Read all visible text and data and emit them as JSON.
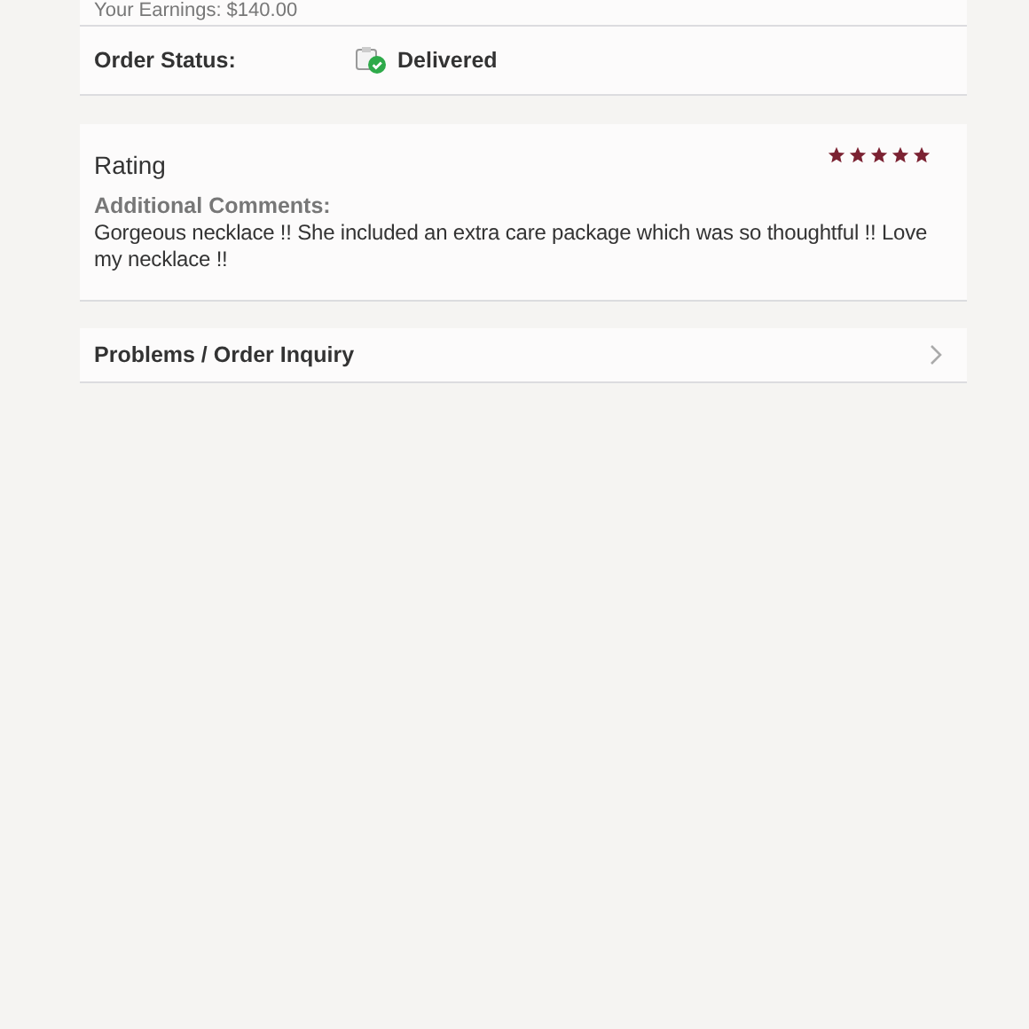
{
  "earnings": {
    "text": "Your Earnings: $140.00"
  },
  "order_status": {
    "label": "Order Status:",
    "value": "Delivered",
    "delivered": true
  },
  "rating": {
    "title": "Rating",
    "stars": 5,
    "comments_label": "Additional Comments:",
    "comments": "Gorgeous necklace !! She included an extra care package which was so thoughtful !! Love my necklace !!"
  },
  "links": [
    {
      "label": "Problems / Order Inquiry"
    }
  ]
}
